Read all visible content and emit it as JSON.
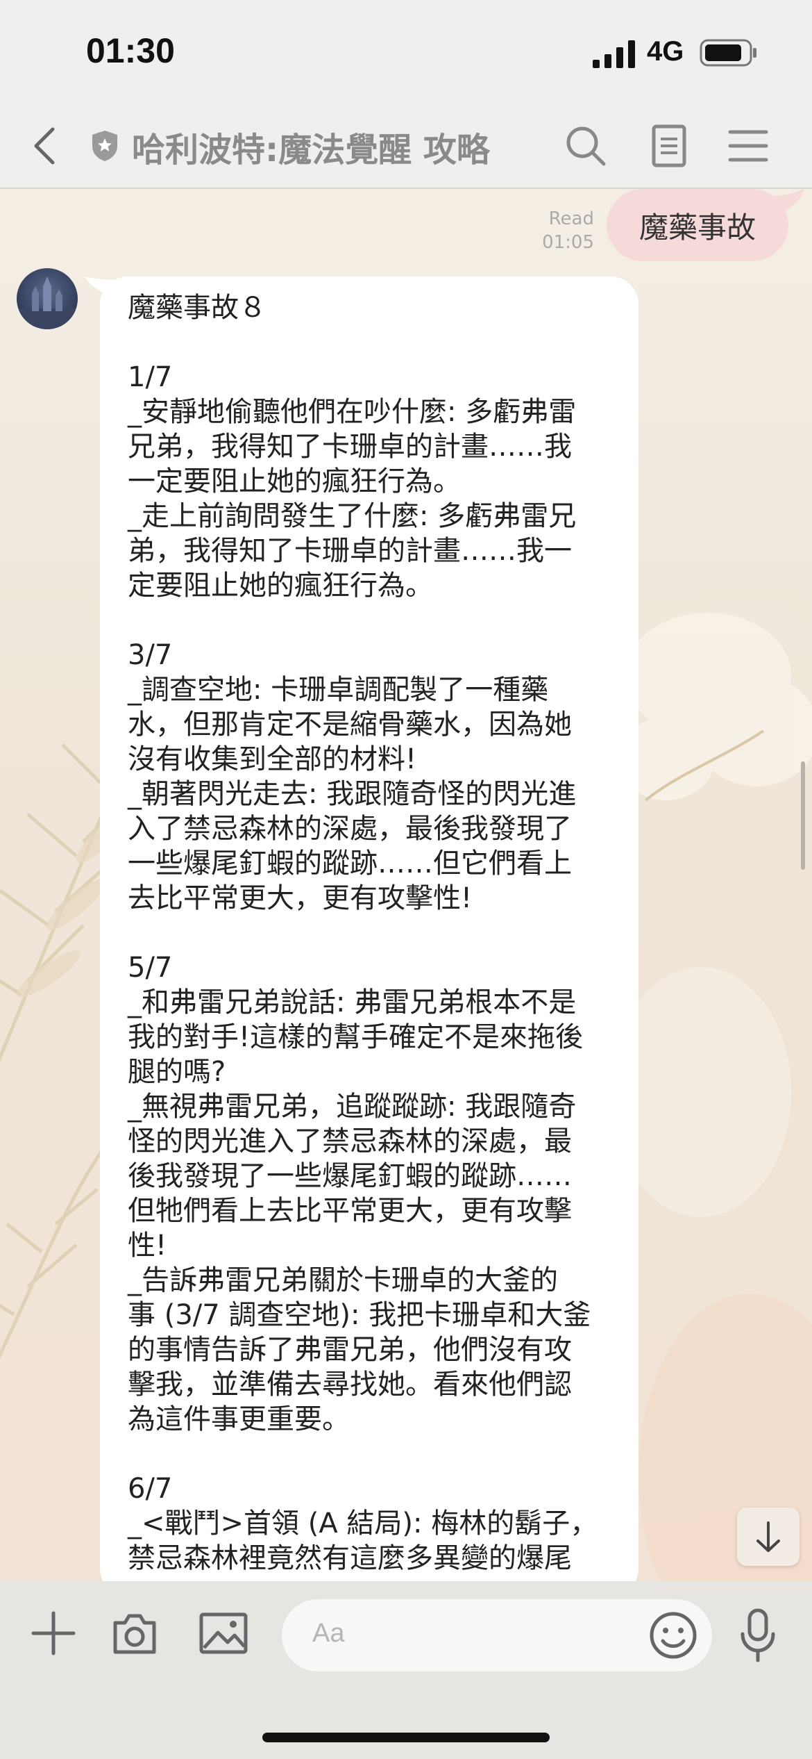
{
  "status_bar": {
    "time": "01:30",
    "network": "4G"
  },
  "header": {
    "title": "哈利波特:魔法覺醒 攻略",
    "icons": [
      "back-icon",
      "shield-icon",
      "search-icon",
      "notes-icon",
      "menu-icon"
    ]
  },
  "chat": {
    "outgoing": {
      "text": "魔藥事故",
      "read_label": "Read",
      "read_time": "01:05"
    },
    "incoming": {
      "text": "魔藥事故８\n\n1/7\n_安靜地偷聽他們在吵什麼: 多虧弗雷\n兄弟，我得知了卡珊卓的計畫……我\n一定要阻止她的瘋狂行為。\n_走上前詢問發生了什麼: 多虧弗雷兄\n弟，我得知了卡珊卓的計畫……我一\n定要阻止她的瘋狂行為。\n\n3/7\n_調查空地: 卡珊卓調配製了一種藥\n水，但那肯定不是縮骨藥水，因為她\n沒有收集到全部的材料!\n_朝著閃光走去: 我跟隨奇怪的閃光進\n入了禁忌森林的深處，最後我發現了\n一些爆尾釘蝦的蹤跡……但它們看上\n去比平常更大，更有攻擊性!\n\n5/7\n_和弗雷兄弟說話: 弗雷兄弟根本不是\n我的對手!這樣的幫手確定不是來拖後\n腿的嗎?\n_無視弗雷兄弟，追蹤蹤跡: 我跟隨奇\n怪的閃光進入了禁忌森林的深處，最\n後我發現了一些爆尾釘蝦的蹤跡……\n但牠們看上去比平常更大，更有攻擊\n性!\n_告訴弗雷兄弟關於卡珊卓的大釜的\n事 (3/7 調查空地): 我把卡珊卓和大釜\n的事情告訴了弗雷兄弟，他們沒有攻\n擊我，並準備去尋找她。看來他們認\n為這件事更重要。\n\n6/7\n_<戰鬥>首領 (A 結局): 梅林的鬍子，\n禁忌森林裡竟然有這麼多異變的爆尾"
    }
  },
  "input_bar": {
    "placeholder": "Aa",
    "icons": [
      "plus-icon",
      "camera-icon",
      "image-icon",
      "emoji-icon",
      "microphone-icon"
    ]
  },
  "colors": {
    "outgoing_bubble": "#f6dada",
    "incoming_bubble": "#ffffff",
    "header_bg": "#efefed",
    "input_bar_bg": "#e7e5e1"
  }
}
